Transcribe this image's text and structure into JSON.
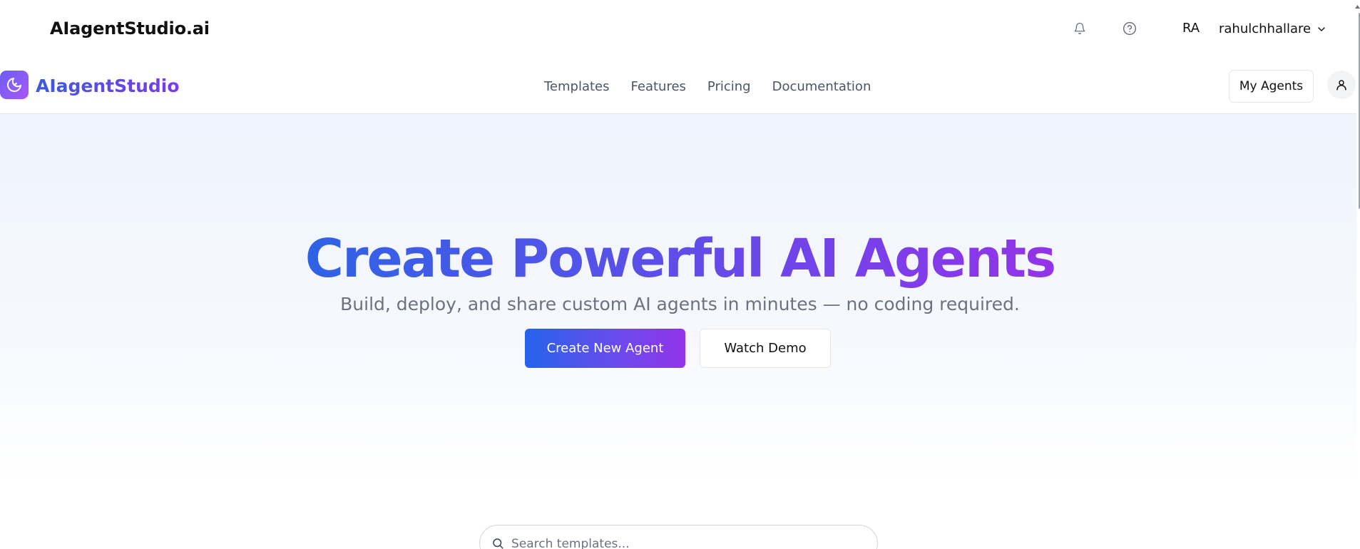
{
  "app_bar": {
    "title": "AIagentStudio.ai",
    "notifications_icon": "bell-icon",
    "help_icon": "help-circle-icon",
    "user_initials": "RA",
    "username": "rahulchhallare",
    "menu_icon": "chevron-down-icon"
  },
  "nav": {
    "logo_icon": "moon-logo-icon",
    "logo_text": "AIagentStudio",
    "links": [
      "Templates",
      "Features",
      "Pricing",
      "Documentation"
    ],
    "my_agents_label": "My Agents",
    "profile_icon": "user-icon"
  },
  "hero": {
    "title": "Create Powerful AI Agents",
    "subtitle": "Build, deploy, and share custom AI agents in minutes — no coding required.",
    "primary_cta": "Create New Agent",
    "secondary_cta": "Watch Demo"
  },
  "search": {
    "placeholder": "Search templates...",
    "value": ""
  },
  "colors": {
    "brand_start": "#2563eb",
    "brand_end": "#9333ea",
    "text_muted": "#6b7280"
  }
}
